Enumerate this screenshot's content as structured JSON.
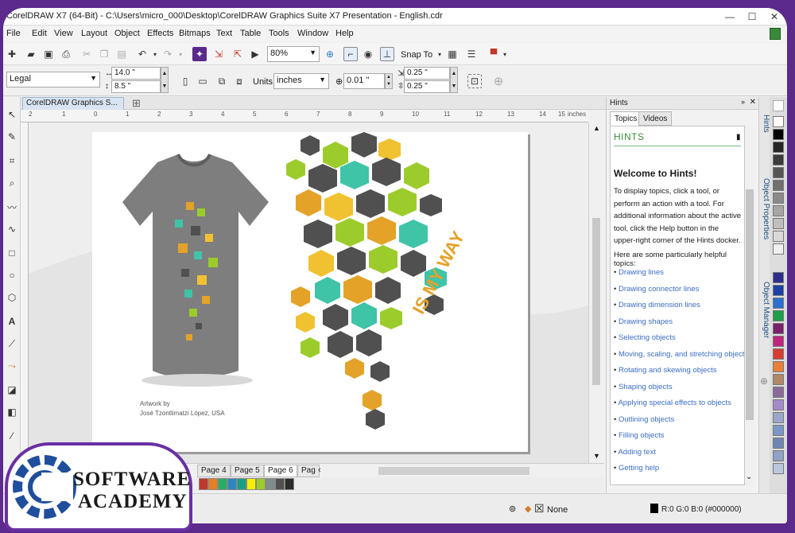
{
  "window": {
    "title": "CorelDRAW X7 (64-Bit) - C:\\Users\\micro_000\\Desktop\\CorelDRAW Graphics Suite X7 Presentation - English.cdr"
  },
  "menu": [
    "File",
    "Edit",
    "View",
    "Layout",
    "Object",
    "Effects",
    "Bitmaps",
    "Text",
    "Table",
    "Tools",
    "Window",
    "Help"
  ],
  "toolbar": {
    "zoom": "80%",
    "snap_to": "Snap To"
  },
  "propbar": {
    "page_size": "Legal",
    "width": "14.0 \"",
    "height": "8.5 \"",
    "units_label": "Units:",
    "units": "inches",
    "nudge": "0.01 \"",
    "dup_x": "0.25 \"",
    "dup_y": "0.25 \""
  },
  "document_tab": "CorelDRAW Graphics S...",
  "ruler": {
    "unit": "inches",
    "ticks": [
      "2",
      "1",
      "0",
      "1",
      "2",
      "3",
      "4",
      "5",
      "6",
      "7",
      "8",
      "9",
      "10",
      "11",
      "12",
      "13",
      "14",
      "15"
    ]
  },
  "artwork": {
    "credit_line1": "Artwork by",
    "credit_line2": "José Tzontlimatzi López, USA",
    "slogan": "IS MY WAY"
  },
  "pages": [
    "Page 4",
    "Page 5",
    "Page 6",
    "Pag"
  ],
  "status": {
    "fill": "None",
    "color_readout": "R:0 G:0 B:0 (#000000)"
  },
  "docker": {
    "title": "Hints",
    "tabs": [
      "Topics",
      "Videos"
    ],
    "heading": "HINTS",
    "welcome": "Welcome to Hints!",
    "intro": "To display topics, click a tool, or perform an action with a tool. For additional information about the active tool, click the Help button in the upper-right corner of the Hints docker.",
    "intro2": "Here are some particularly helpful topics:",
    "topics": [
      "Drawing lines",
      "Drawing connector lines",
      "Drawing dimension lines",
      "Drawing shapes",
      "Selecting objects",
      "Moving, scaling, and stretching objects",
      "Rotating and skewing objects",
      "Shaping objects",
      "Applying special effects to objects",
      "Outlining objects",
      "Filling objects",
      "Adding text",
      "Getting help"
    ]
  },
  "side_tabs": [
    "Hints",
    "Object Properties",
    "Object Manager"
  ],
  "watermark": {
    "line1": "SOFTWARES",
    "line2": "ACADEMY"
  },
  "colors": {
    "accent_green": "#3a8b3a",
    "link_blue": "#3b6dc4",
    "frame_purple": "#5b2a8c"
  }
}
